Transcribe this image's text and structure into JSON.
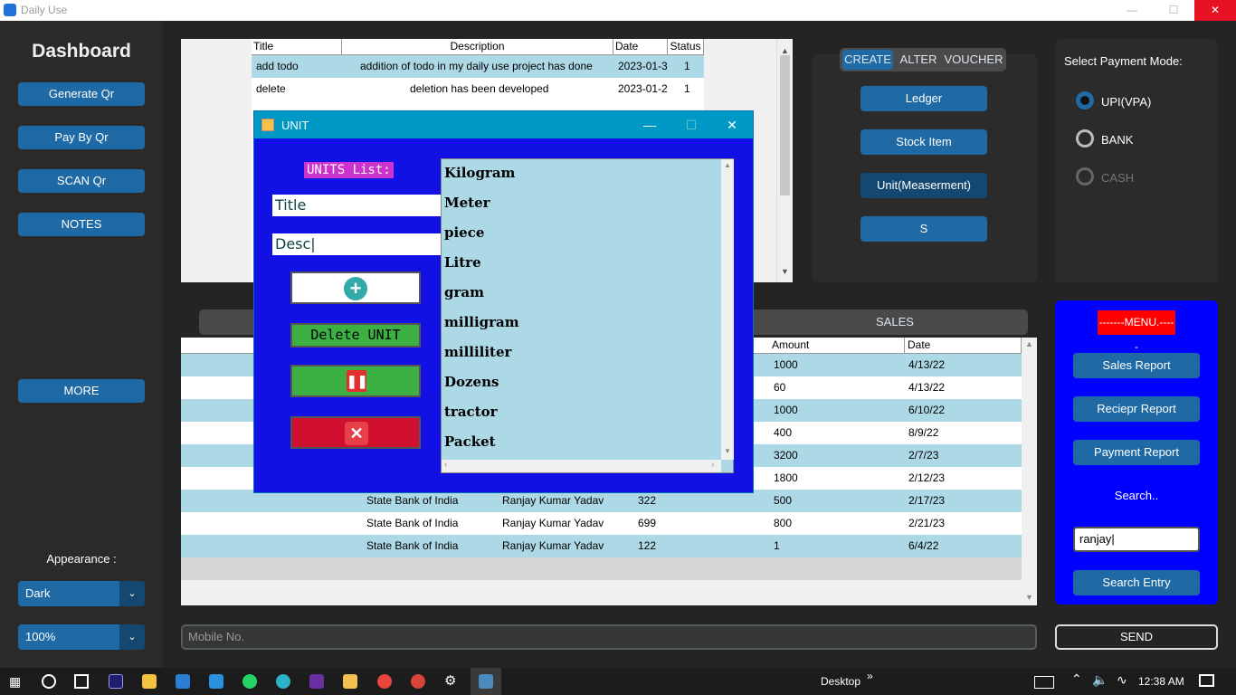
{
  "window": {
    "title": "Daily Use"
  },
  "sidebar": {
    "title": "Dashboard",
    "buttons": [
      "Generate Qr",
      "Pay By Qr",
      "SCAN Qr",
      "NOTES",
      "MORE"
    ],
    "appearance_label": "Appearance :",
    "theme": "Dark",
    "zoom": "100%"
  },
  "todo": {
    "headers": [
      "Title",
      "Description",
      "Date",
      "Status"
    ],
    "rows": [
      [
        "add todo",
        "addition of todo in my daily use project has done",
        "2023-01-3",
        "1"
      ],
      [
        "delete",
        "deletion has been developed",
        "2023-01-2",
        "1"
      ]
    ]
  },
  "segment": {
    "tabs": [
      "CREATE",
      "ALTER",
      "VOUCHER"
    ]
  },
  "create_buttons": [
    "Ledger",
    "Stock Item",
    "Unit(Measerment)",
    "S"
  ],
  "payment": {
    "label": "Select Payment Mode:",
    "options": [
      "UPI(VPA)",
      "BANK",
      "CASH"
    ]
  },
  "tabs": {
    "sales": "SALES"
  },
  "table": {
    "headers": {
      "amount": "Amount",
      "date": "Date"
    },
    "rows": [
      {
        "bank": "",
        "name": "",
        "id": "",
        "amount": "1000",
        "date": "4/13/22"
      },
      {
        "bank": "",
        "name": "",
        "id": "",
        "amount": "60",
        "date": "4/13/22"
      },
      {
        "bank": "",
        "name": "",
        "id": "",
        "amount": "1000",
        "date": "6/10/22"
      },
      {
        "bank": "",
        "name": "",
        "id": "",
        "amount": "400",
        "date": "8/9/22"
      },
      {
        "bank": "",
        "name": "",
        "id": "",
        "amount": "3200",
        "date": "2/7/23"
      },
      {
        "bank": "",
        "name": "",
        "id": "",
        "amount": "1800",
        "date": "2/12/23"
      },
      {
        "bank": "State Bank of India",
        "name": "Ranjay Kumar Yadav",
        "id": "322",
        "amount": "500",
        "date": "2/17/23"
      },
      {
        "bank": "State Bank of India",
        "name": "Ranjay Kumar Yadav",
        "id": "699",
        "amount": "800",
        "date": "2/21/23"
      },
      {
        "bank": "State Bank of India",
        "name": "Ranjay Kumar Yadav",
        "id": "122",
        "amount": "1",
        "date": "6/4/22"
      }
    ]
  },
  "menu": {
    "title": "-------MENU.-----",
    "buttons": [
      "Sales Report",
      "Reciepr Report",
      "Payment Report"
    ],
    "search_label": "Search..",
    "search_value": "ranjay",
    "search_button": "Search Entry"
  },
  "mobile": {
    "placeholder": "Mobile No.",
    "send": "SEND"
  },
  "dialog": {
    "title": "UNIT",
    "list_label": "UNITS List:",
    "title_value": "Title",
    "desc_value": "Desc",
    "delete_label": "Delete UNIT",
    "units": [
      "Kilogram",
      "Meter",
      "piece",
      "Litre",
      "gram",
      "milligram",
      "milliliter",
      "Dozens",
      "tractor",
      "Packet"
    ]
  },
  "taskbar": {
    "desktop": "Desktop",
    "time": "12:38 AM"
  },
  "colors": {
    "accent": "#1f6aa5",
    "dialog_bg": "#1111e6",
    "list_bg": "#add8e6",
    "menu_bg": "#0000ff",
    "close_red": "#e81123"
  }
}
